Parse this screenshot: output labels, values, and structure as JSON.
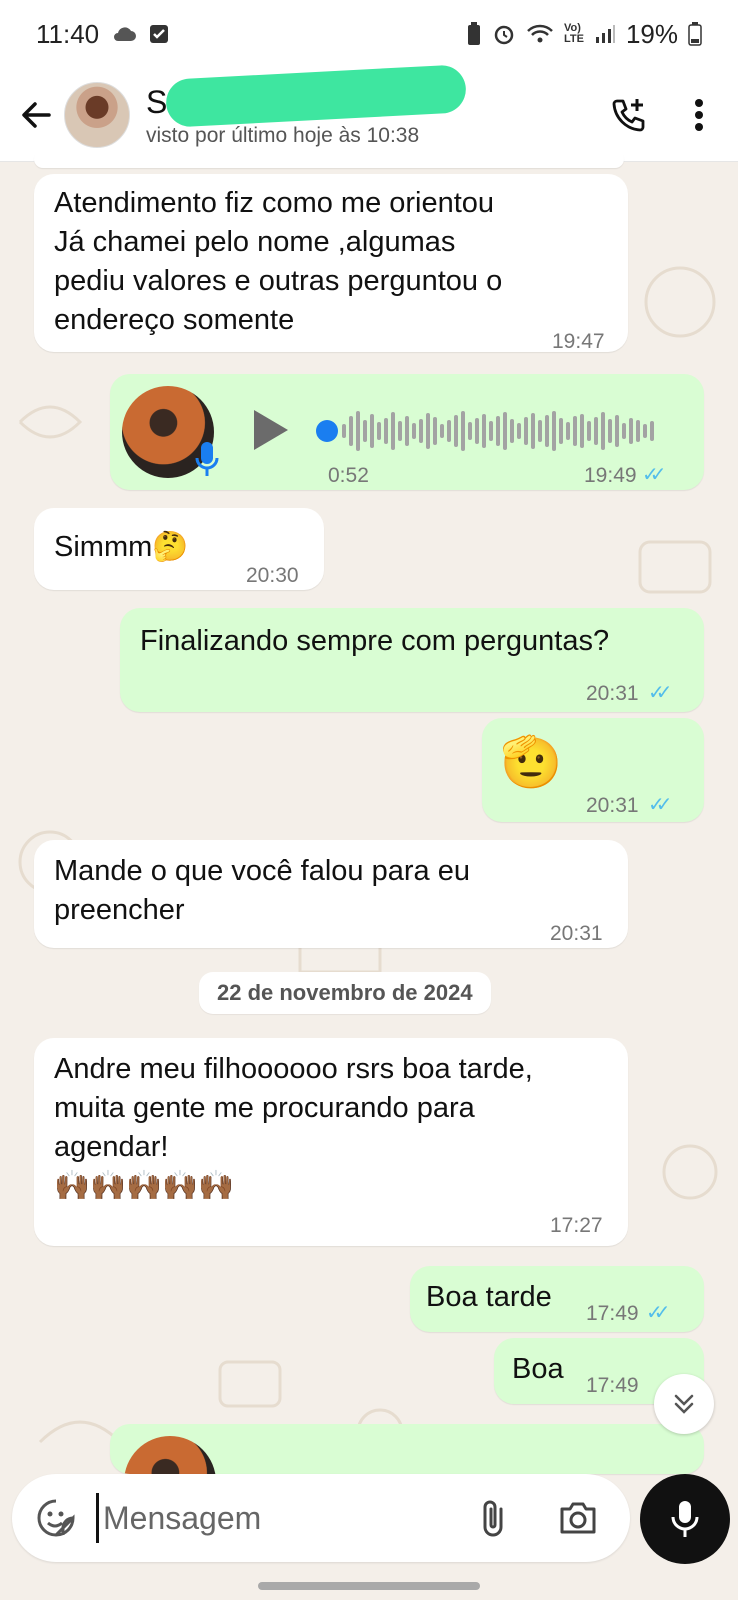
{
  "status_bar": {
    "time": "11:40",
    "battery": "19%"
  },
  "header": {
    "contact_name": "S",
    "last_seen": "visto por último hoje às 10:38"
  },
  "messages": [
    {
      "dir": "in",
      "text": "Atendimento fiz como me orientou\nJá chamei pelo nome ,algumas\npediu valores e outras perguntou o\nendereço somente",
      "time": "19:47"
    },
    {
      "dir": "out",
      "type": "audio",
      "duration": "0:52",
      "time": "19:49"
    },
    {
      "dir": "in",
      "text": "Simmm🤔",
      "time": "20:30"
    },
    {
      "dir": "out",
      "text": "Finalizando sempre com perguntas?",
      "time": "20:31"
    },
    {
      "dir": "out",
      "text": "🫡",
      "time": "20:31"
    },
    {
      "dir": "in",
      "text": "Mande o que você falou para eu\npreencher",
      "time": "20:31"
    },
    {
      "dir": "in",
      "text": "Andre meu filhoooooo rsrs boa tarde,\nmuita gente me procurando para\nagendar!\n🙌🏾🙌🏾🙌🏾🙌🏾🙌🏾",
      "time": "17:27"
    },
    {
      "dir": "out",
      "text": "Boa tarde",
      "time": "17:49"
    },
    {
      "dir": "out",
      "text": "Boa",
      "time": "17:49"
    }
  ],
  "date_divider": "22 de novembro de 2024",
  "input": {
    "placeholder": "Mensagem"
  },
  "icons": [
    "back-arrow-icon",
    "add-call-icon",
    "more-vertical-icon",
    "sticker-icon",
    "attach-icon",
    "camera-icon",
    "mic-icon",
    "chevron-down-icon",
    "double-check-icon",
    "play-icon"
  ],
  "colors": {
    "incoming": "#ffffff",
    "outgoing": "#d9fdd3",
    "read_ticks": "#53bdeb",
    "audio_dot": "#1a7ef0",
    "background": "#f4efe9"
  }
}
